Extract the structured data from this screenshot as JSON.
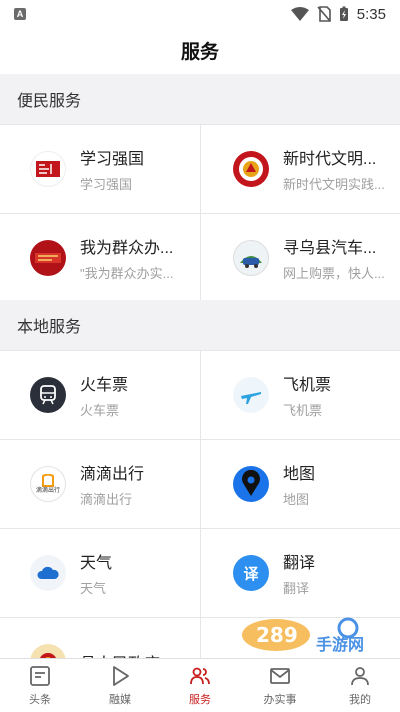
{
  "status_bar": {
    "time": "5:35",
    "left_badge": "A"
  },
  "title": "服务",
  "sections": [
    {
      "title": "便民服务"
    },
    {
      "title": "本地服务"
    }
  ],
  "services_convenience": [
    {
      "title": "学习强国",
      "subtitle": "学习强国",
      "icon": "xuexi-qiangguo-logo"
    },
    {
      "title": "新时代文明...",
      "subtitle": "新时代文明实践...",
      "icon": "civilization-practice-logo"
    },
    {
      "title": "我为群众办...",
      "subtitle": "\"我为群众办实...",
      "icon": "serve-the-people-logo"
    },
    {
      "title": "寻乌县汽车...",
      "subtitle": "网上购票，快人...",
      "icon": "xunwu-bus-logo"
    }
  ],
  "services_local": [
    {
      "title": "火车票",
      "subtitle": "火车票",
      "icon": "train-icon"
    },
    {
      "title": "飞机票",
      "subtitle": "飞机票",
      "icon": "airplane-icon"
    },
    {
      "title": "滴滴出行",
      "subtitle": "滴滴出行",
      "icon": "didi-logo",
      "logo_text": "滴滴出行"
    },
    {
      "title": "地图",
      "subtitle": "地图",
      "icon": "map-pin-icon"
    },
    {
      "title": "天气",
      "subtitle": "天气",
      "icon": "cloud-icon"
    },
    {
      "title": "翻译",
      "subtitle": "翻译",
      "icon": "translate-icon",
      "logo_text": "译"
    },
    {
      "title": "县人民政府",
      "subtitle": "",
      "icon": "county-government-logo"
    }
  ],
  "bottom_nav": [
    {
      "label": "头条",
      "icon": "headlines-icon",
      "active": false
    },
    {
      "label": "融媒",
      "icon": "play-icon",
      "active": false
    },
    {
      "label": "服务",
      "icon": "people-icon",
      "active": true
    },
    {
      "label": "办实事",
      "icon": "mail-icon",
      "active": false
    },
    {
      "label": "我的",
      "icon": "user-icon",
      "active": false
    }
  ],
  "watermark": {
    "brand": "289",
    "text": "手游网"
  },
  "colors": {
    "accent": "#c81e1e",
    "section_bg": "#f2f2f4",
    "subtitle": "#a0a0a0"
  }
}
